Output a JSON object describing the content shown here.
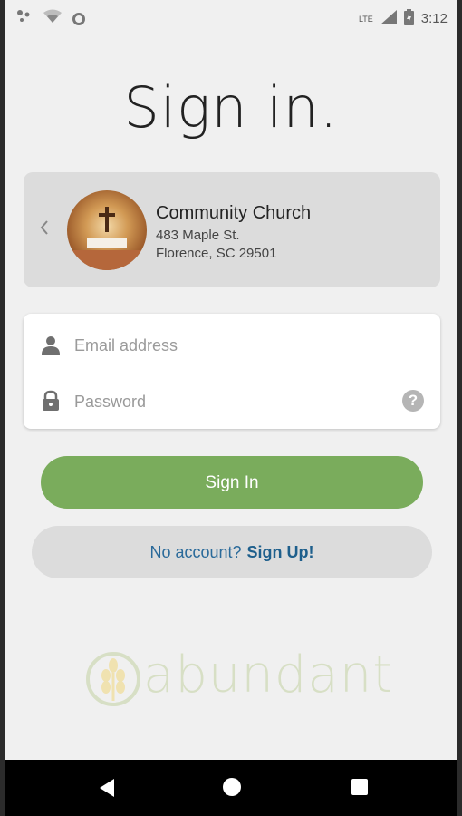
{
  "status_bar": {
    "time": "3:12",
    "network": "LTE"
  },
  "page_title": "Sign in.",
  "church": {
    "name": "Community Church",
    "address_line1": "483 Maple St.",
    "address_line2": "Florence, SC 29501"
  },
  "form": {
    "email_placeholder": "Email address",
    "password_placeholder": "Password"
  },
  "signin_button_label": "Sign In",
  "signup": {
    "prompt": "No account?",
    "link": "Sign Up!"
  },
  "logo_text": "abundant",
  "colors": {
    "accent_green": "#7aac5c",
    "link_blue": "#1e5f8c",
    "logo_tint": "#d7dfc5"
  },
  "icons": [
    "person-icon",
    "lock-icon",
    "help-icon",
    "chevron-left-icon",
    "back-icon",
    "home-icon",
    "recents-icon"
  ]
}
